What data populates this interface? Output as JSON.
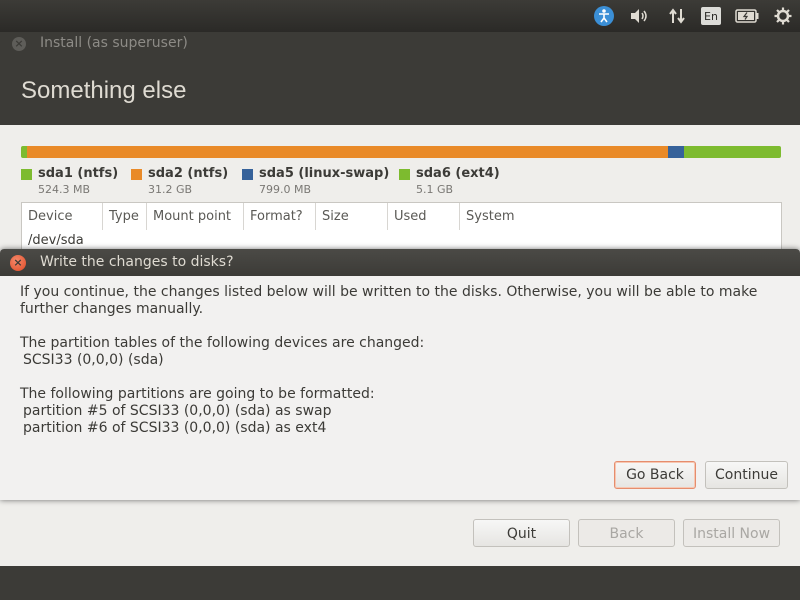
{
  "panel": {
    "lang": "En",
    "icons": [
      "accessibility-icon",
      "volume-icon",
      "network-icon",
      "keyboard-language-icon",
      "battery-icon",
      "gear-icon"
    ]
  },
  "window": {
    "title": "Install (as superuser)"
  },
  "header": {
    "title": "Something else"
  },
  "partitions": {
    "bar": [
      {
        "name": "sda1",
        "color": "#7dbb2f",
        "fraction": 0.008
      },
      {
        "name": "sda2",
        "color": "#e98a28",
        "fraction": 0.843
      },
      {
        "name": "sda5",
        "color": "#36629a",
        "fraction": 0.022
      },
      {
        "name": "sda6",
        "color": "#7dbb2f",
        "fraction": 0.127
      }
    ],
    "legend": [
      {
        "label": "sda1 (ntfs)",
        "size": "524.3 MB",
        "color": "#7dbb2f"
      },
      {
        "label": "sda2 (ntfs)",
        "size": "31.2 GB",
        "color": "#e98a28"
      },
      {
        "label": "sda5 (linux-swap)",
        "size": "799.0 MB",
        "color": "#36629a"
      },
      {
        "label": "sda6 (ext4)",
        "size": "5.1 GB",
        "color": "#7dbb2f"
      }
    ]
  },
  "table": {
    "columns": [
      "Device",
      "Type",
      "Mount point",
      "Format?",
      "Size",
      "Used",
      "System"
    ],
    "rows": [
      {
        "device": "/dev/sda"
      }
    ]
  },
  "buttons": {
    "quit": "Quit",
    "back": "Back",
    "install_now": "Install Now"
  },
  "dialog": {
    "title": "Write the changes to disks?",
    "intro": "If you continue, the changes listed below will be written to the disks. Otherwise, you will be able to make further changes manually.",
    "tables_heading": "The partition tables of the following devices are changed:",
    "tables_items": [
      "SCSI33 (0,0,0) (sda)"
    ],
    "format_heading": "The following partitions are going to be formatted:",
    "format_items": [
      "partition #5 of SCSI33 (0,0,0) (sda) as swap",
      "partition #6 of SCSI33 (0,0,0) (sda) as ext4"
    ],
    "go_back": "Go Back",
    "continue": "Continue"
  }
}
